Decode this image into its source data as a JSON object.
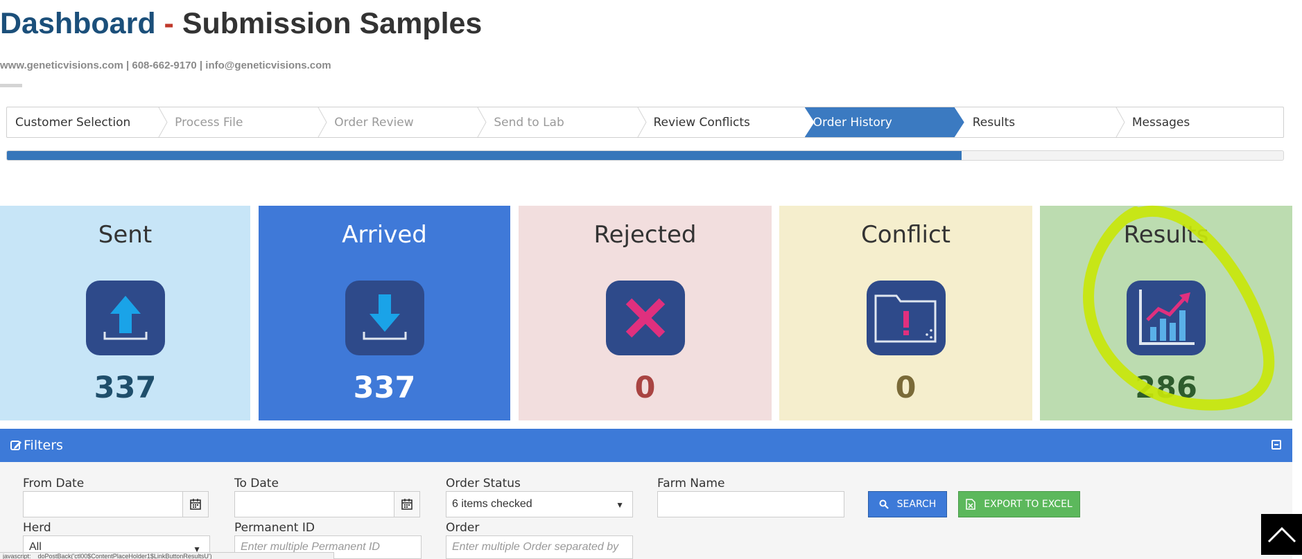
{
  "header": {
    "title_dashboard": "Dashboard",
    "title_separator": " - ",
    "title_rest": "Submission Samples",
    "contact": "www.geneticvisions.com | 608-662-9170 | info@geneticvisions.com"
  },
  "wizard": {
    "steps": [
      {
        "label": "Customer Selection",
        "state": "normal"
      },
      {
        "label": "Process File",
        "state": "dim"
      },
      {
        "label": "Order Review",
        "state": "dim"
      },
      {
        "label": "Send to Lab",
        "state": "dim"
      },
      {
        "label": "Review Conflicts",
        "state": "normal"
      },
      {
        "label": "Order History",
        "state": "active"
      },
      {
        "label": "Results",
        "state": "normal"
      },
      {
        "label": "Messages",
        "state": "normal"
      }
    ],
    "progress_percent": 74.8
  },
  "cards": {
    "sent": {
      "title": "Sent",
      "count": "337",
      "icon": "upload-icon"
    },
    "arrived": {
      "title": "Arrived",
      "count": "337",
      "icon": "download-icon"
    },
    "rejected": {
      "title": "Rejected",
      "count": "0",
      "icon": "x-icon"
    },
    "conflict": {
      "title": "Conflict",
      "count": "0",
      "icon": "folder-alert-icon"
    },
    "results": {
      "title": "Results",
      "count": "286",
      "icon": "chart-trend-icon"
    }
  },
  "filters": {
    "header": "Filters",
    "from_date_label": "From Date",
    "from_date_value": "",
    "to_date_label": "To Date",
    "to_date_value": "",
    "order_status_label": "Order Status",
    "order_status_value": "6 items checked",
    "farm_name_label": "Farm Name",
    "farm_name_value": "",
    "herd_label": "Herd",
    "herd_value": "All",
    "permanent_id_label": "Permanent ID",
    "permanent_id_placeholder": "Enter multiple Permanent ID",
    "order_label": "Order",
    "order_placeholder": "Enter multiple Order separated by",
    "search_label": "SEARCH",
    "export_label": "EXPORT TO EXCEL"
  },
  "statusbar": {
    "text": "javascript:__doPostBack('ctl00$ContentPlaceHolder1$LinkButtonResultsU')"
  },
  "colors": {
    "accent": "#3d7ad8",
    "active_step": "#3b7ac1",
    "icon_bg": "#2e4a8a",
    "highlight": "#c8e60a"
  }
}
